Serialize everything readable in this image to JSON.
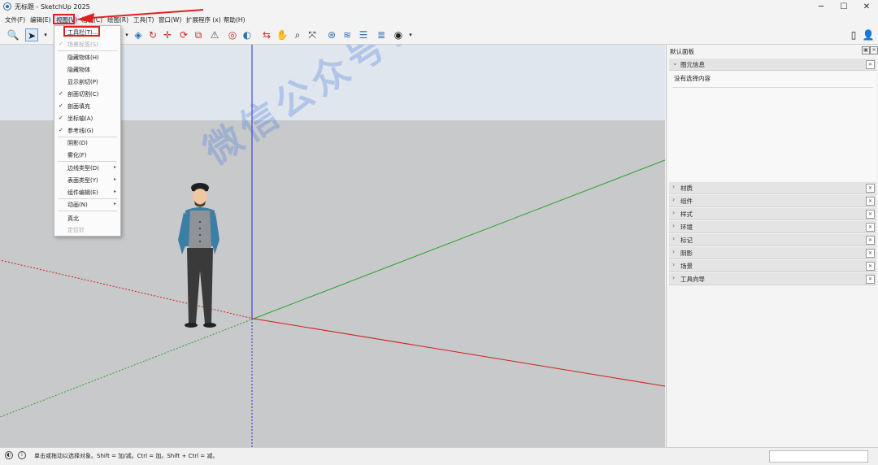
{
  "window": {
    "title": "无标题 - SketchUp 2025",
    "minimize": "─",
    "maximize": "☐",
    "close": "✕"
  },
  "menubar": {
    "items": [
      {
        "label": "文件(F)"
      },
      {
        "label": "编辑(E)"
      },
      {
        "label": "视图(V)"
      },
      {
        "label": "相机(C)"
      },
      {
        "label": "绘图(R)"
      },
      {
        "label": "工具(T)"
      },
      {
        "label": "窗口(W)"
      },
      {
        "label": "扩展程序 (x)"
      },
      {
        "label": "帮助(H)"
      }
    ]
  },
  "view_menu": {
    "items": [
      {
        "label": "工具栏(T)...",
        "checked": false,
        "disabled": false,
        "submenu": false,
        "highlighted": true
      },
      {
        "label": "场景标签(S)",
        "checked": true,
        "disabled": true,
        "submenu": false
      },
      {
        "label": "隐藏物体(H)",
        "checked": false,
        "disabled": false,
        "submenu": false
      },
      {
        "label": "隐藏物体",
        "checked": false,
        "disabled": false,
        "submenu": false
      },
      {
        "label": "显示剖切(P)",
        "checked": false,
        "disabled": false,
        "submenu": false
      },
      {
        "label": "剖面切割(C)",
        "checked": true,
        "disabled": false,
        "submenu": false
      },
      {
        "label": "剖面填充",
        "checked": true,
        "disabled": false,
        "submenu": false
      },
      {
        "label": "坐标轴(A)",
        "checked": true,
        "disabled": false,
        "submenu": false
      },
      {
        "label": "参考线(G)",
        "checked": true,
        "disabled": false,
        "submenu": false
      },
      {
        "label": "阴影(D)",
        "checked": false,
        "disabled": false,
        "submenu": false
      },
      {
        "label": "雾化(F)",
        "checked": false,
        "disabled": false,
        "submenu": false
      },
      {
        "label": "边线类型(D)",
        "checked": false,
        "disabled": false,
        "submenu": true
      },
      {
        "label": "表面类型(Y)",
        "checked": false,
        "disabled": false,
        "submenu": true
      },
      {
        "label": "组件编辑(E)",
        "checked": false,
        "disabled": false,
        "submenu": true
      },
      {
        "label": "动画(N)",
        "checked": false,
        "disabled": false,
        "submenu": true
      },
      {
        "label": "真北",
        "checked": false,
        "disabled": false,
        "submenu": false
      },
      {
        "label": "定位针",
        "checked": false,
        "disabled": true,
        "submenu": false
      }
    ]
  },
  "toolbar": {
    "icons": [
      "search-icon",
      "select-arrow-icon",
      "paint-bucket-icon",
      "push-pull-icon",
      "follow-me-icon",
      "move-icon",
      "rotate-icon",
      "scale-icon",
      "warning-icon",
      "tape-measure-icon",
      "protractor-icon",
      "orbit-icon",
      "pan-icon",
      "zoom-icon",
      "zoom-extents-icon",
      "camera-icon",
      "section-icon",
      "layers-icon",
      "styles-icon",
      "account-icon",
      "new-file-icon",
      "profile-icon"
    ]
  },
  "tray": {
    "title": "默认面板",
    "entity_info": {
      "label": "图元信息",
      "message": "没有选择内容"
    },
    "sections": [
      {
        "label": "材质"
      },
      {
        "label": "组件"
      },
      {
        "label": "样式"
      },
      {
        "label": "环境"
      },
      {
        "label": "标记"
      },
      {
        "label": "阴影"
      },
      {
        "label": "场景"
      },
      {
        "label": "工具向导"
      }
    ]
  },
  "watermark": "微信公众号：不迷路资源库",
  "statusbar": {
    "text": "单击或拖动以选择对象。Shift = 加/减。Ctrl = 加。Shift + Ctrl = 减。"
  },
  "colors": {
    "sky": "#e0e6ee",
    "ground": "#c7c9cb",
    "axis_red": "#d02020",
    "axis_green": "#20a020",
    "axis_blue": "#2020d0",
    "highlight": "#e02020"
  }
}
